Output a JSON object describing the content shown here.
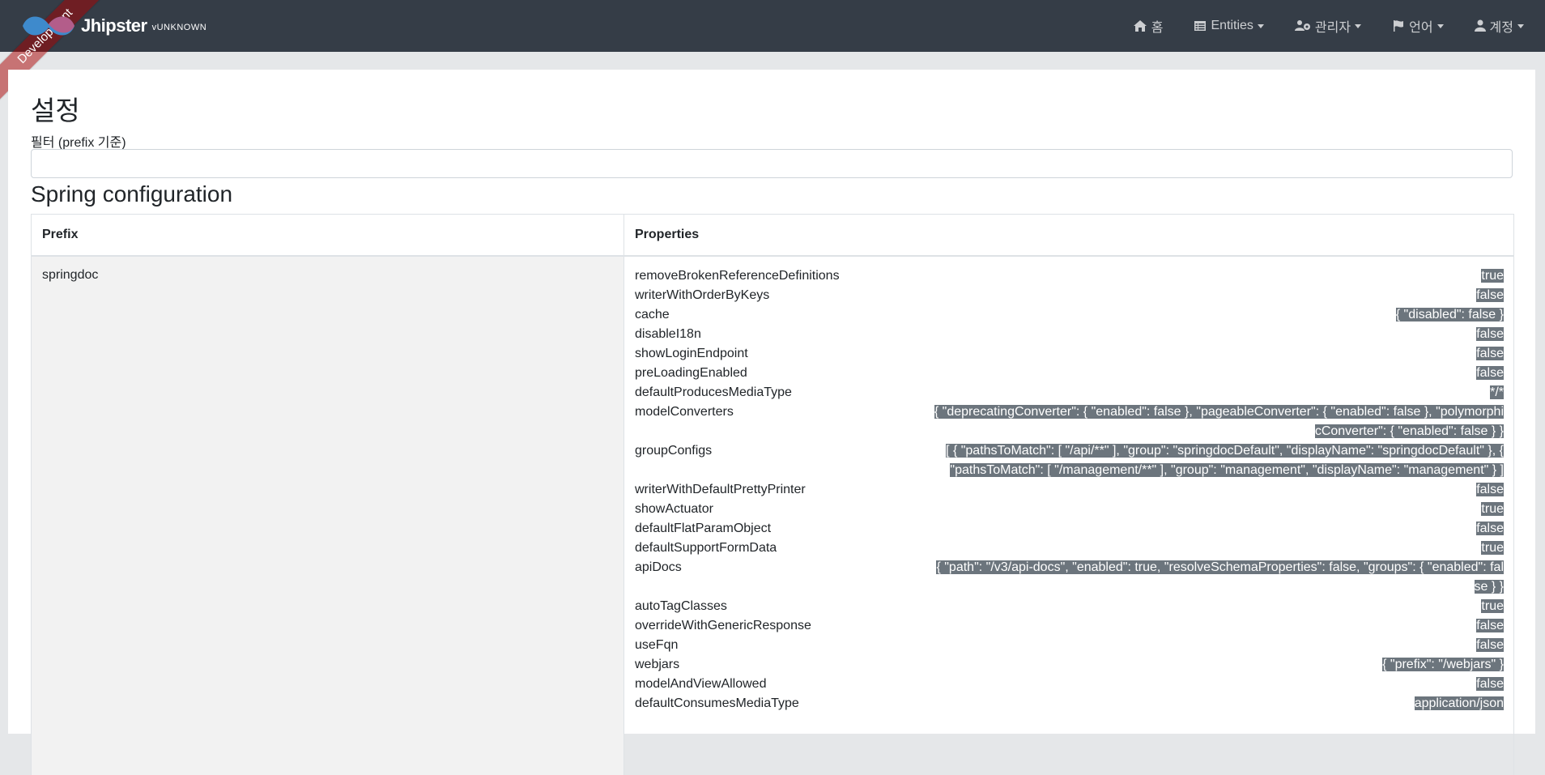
{
  "navbar": {
    "brand": "Jhipster",
    "version": "vUNKNOWN",
    "ribbon": "Development",
    "items": [
      {
        "label": "홈",
        "icon": "home-icon",
        "dropdown": false
      },
      {
        "label": "Entities",
        "icon": "table-list-icon",
        "dropdown": true
      },
      {
        "label": "관리자",
        "icon": "users-gear-icon",
        "dropdown": true
      },
      {
        "label": "언어",
        "icon": "flag-icon",
        "dropdown": true
      },
      {
        "label": "계정",
        "icon": "user-icon",
        "dropdown": true
      }
    ]
  },
  "page": {
    "title": "설정",
    "filter_label": "필터 (prefix 기준)",
    "filter_value": "",
    "section_title": "Spring configuration"
  },
  "table": {
    "headers": [
      "Prefix",
      "Properties"
    ],
    "prefix": "springdoc",
    "properties": [
      {
        "key": "removeBrokenReferenceDefinitions",
        "value": "true"
      },
      {
        "key": "writerWithOrderByKeys",
        "value": "false"
      },
      {
        "key": "cache",
        "value": "{ \"disabled\": false }"
      },
      {
        "key": "disableI18n",
        "value": "false"
      },
      {
        "key": "showLoginEndpoint",
        "value": "false"
      },
      {
        "key": "preLoadingEnabled",
        "value": "false"
      },
      {
        "key": "defaultProducesMediaType",
        "value": "*/*"
      },
      {
        "key": "modelConverters",
        "value": "{ \"deprecatingConverter\": { \"enabled\": false }, \"pageableConverter\": { \"enabled\": false }, \"polymorphicConverter\": { \"enabled\": false } }"
      },
      {
        "key": "groupConfigs",
        "value": "[ { \"pathsToMatch\": [ \"/api/**\" ], \"group\": \"springdocDefault\", \"displayName\": \"springdocDefault\" }, { \"pathsToMatch\": [ \"/management/**\" ], \"group\": \"management\", \"displayName\": \"management\" } ]"
      },
      {
        "key": "writerWithDefaultPrettyPrinter",
        "value": "false"
      },
      {
        "key": "showActuator",
        "value": "true"
      },
      {
        "key": "defaultFlatParamObject",
        "value": "false"
      },
      {
        "key": "defaultSupportFormData",
        "value": "true"
      },
      {
        "key": "apiDocs",
        "value": "{ \"path\": \"/v3/api-docs\", \"enabled\": true, \"resolveSchemaProperties\": false, \"groups\": { \"enabled\": false } }"
      },
      {
        "key": "autoTagClasses",
        "value": "true"
      },
      {
        "key": "overrideWithGenericResponse",
        "value": "false"
      },
      {
        "key": "useFqn",
        "value": "false"
      },
      {
        "key": "webjars",
        "value": "{ \"prefix\": \"/webjars\" }"
      },
      {
        "key": "modelAndViewAllowed",
        "value": "false"
      },
      {
        "key": "defaultConsumesMediaType",
        "value": "application/json"
      }
    ]
  }
}
